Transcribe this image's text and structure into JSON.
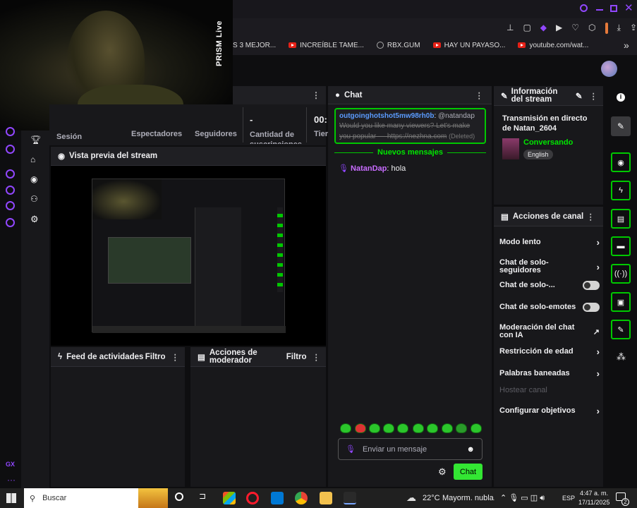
{
  "webcam": {
    "overlay_label": "PRISM Live"
  },
  "bookmarks": [
    {
      "label": "S 3 MEJOR...",
      "icon": "youtube-icon"
    },
    {
      "label": "INCREÍBLE TAME...",
      "icon": "youtube-icon"
    },
    {
      "label": "RBX.GUM",
      "icon": "globe-icon"
    },
    {
      "label": "HAY UN PAYASO...",
      "icon": "youtube-icon"
    },
    {
      "label": "youtube.com/wat...",
      "icon": "youtube-icon"
    }
  ],
  "stats": {
    "session": "Sesión",
    "viewers": "Espectadores",
    "followers": "Seguidores",
    "subs": "Cantidad de suscripciones",
    "subs_value": "-",
    "time_label": "Tiem",
    "time_value": "00:"
  },
  "preview": {
    "title": "Vista previa del stream"
  },
  "activity": {
    "title": "Feed de actividades",
    "filter": "Filtro"
  },
  "modactions": {
    "title": "Acciones de moderador",
    "filter": "Filtro"
  },
  "chat": {
    "title": "Chat",
    "pinned_user": "outgoinghotshot5mw98rh0b",
    "pinned_mention": "@natandap",
    "pinned_text": "Would you like many viewers? Let's make you popular — https://nezhna.com",
    "pinned_status": "(Deleted)",
    "new_messages": "Nuevos mensajes",
    "messages": [
      {
        "user": "NatanDap",
        "text": "hola"
      }
    ],
    "input_placeholder": "Enviar un mensaje",
    "send_label": "Chat"
  },
  "stream_info": {
    "title": "Información del stream",
    "stream_title": "Transmisión en directo de Natan_2604",
    "category": "Conversando",
    "language": "English"
  },
  "channel_actions": {
    "title": "Acciones de canal",
    "items": [
      {
        "label": "Modo lento",
        "control": "chevron"
      },
      {
        "label": "Chat de solo-seguidores",
        "control": "chevron"
      },
      {
        "label": "Chat de solo-...",
        "control": "toggle"
      },
      {
        "label": "Chat de solo-emotes",
        "control": "toggle"
      },
      {
        "label": "Moderación del chat con IA",
        "control": "external"
      },
      {
        "label": "Restricción de edad",
        "control": "chevron"
      },
      {
        "label": "Palabras baneadas",
        "control": "chevron"
      },
      {
        "label": "Hostear canal",
        "control": "disabled"
      },
      {
        "label": "Configurar objetivos",
        "control": "chevron"
      }
    ]
  },
  "leftnav": {
    "gx_label": "GX"
  },
  "taskbar": {
    "search": "Buscar",
    "weather_temp": "22°C",
    "weather_text": "Mayorm. nubla...",
    "lang": "ESP",
    "time": "4:47 a. m.",
    "date": "17/11/2025",
    "notif_count": "2"
  },
  "colors": {
    "accent": "#00c800",
    "brand": "#9147ff",
    "chat_name": "#9147ff"
  }
}
